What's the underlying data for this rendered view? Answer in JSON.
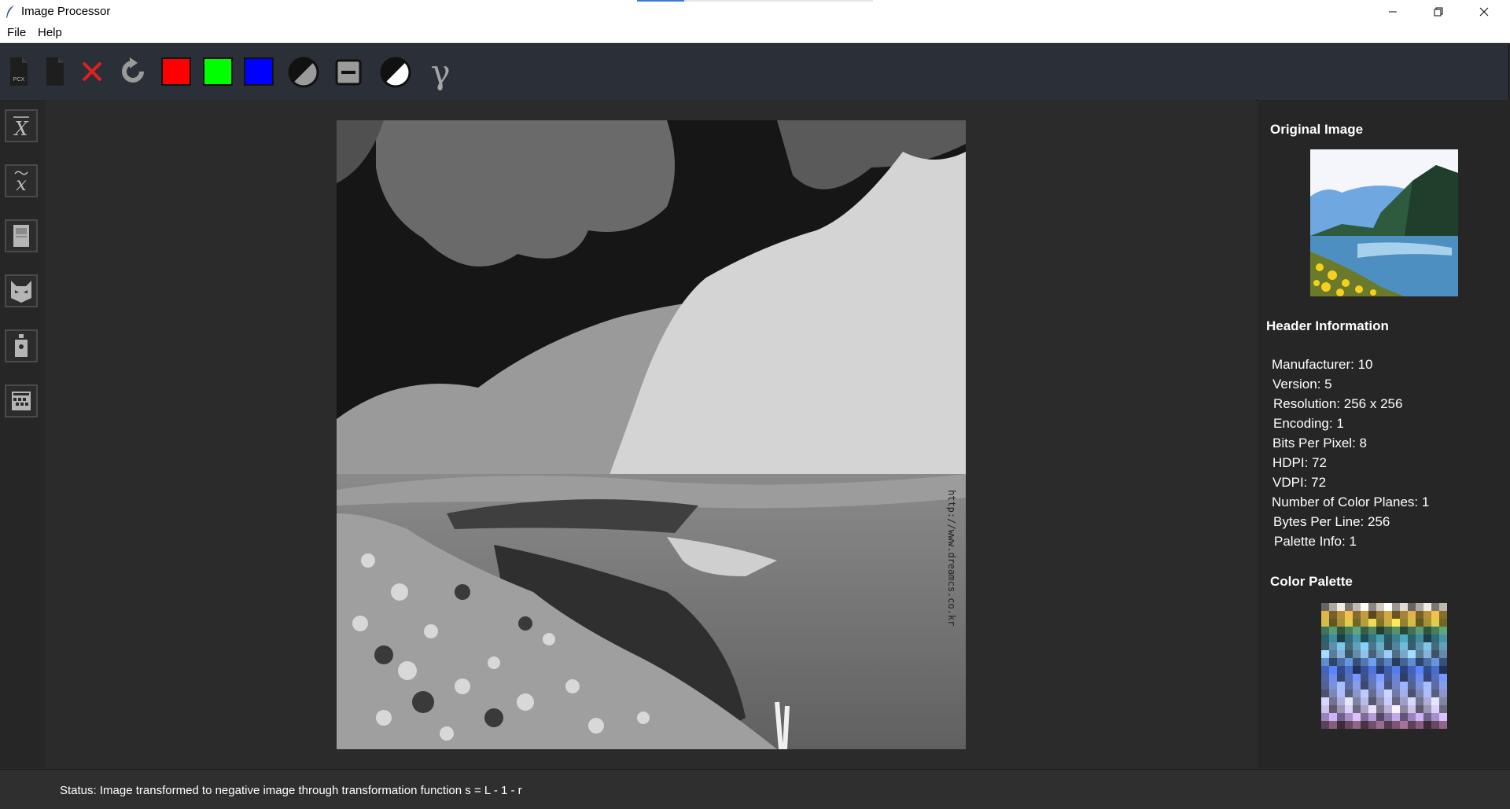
{
  "window": {
    "title": "Image Processor",
    "controls": [
      "minimize-icon",
      "restore-icon",
      "close-icon"
    ]
  },
  "menu": {
    "items": [
      "File",
      "Help"
    ]
  },
  "toolbar": {
    "buttons": [
      {
        "name": "open-pcx-button",
        "icon": "pcx-file-icon",
        "label": "PCX"
      },
      {
        "name": "save-file-button",
        "icon": "file-icon"
      },
      {
        "name": "close-image-button",
        "icon": "red-x-icon"
      },
      {
        "name": "reset-button",
        "icon": "refresh-icon"
      },
      {
        "name": "red-channel-button",
        "icon": "red-square",
        "color": "#ff0000"
      },
      {
        "name": "green-channel-button",
        "icon": "green-square",
        "color": "#00ff00"
      },
      {
        "name": "blue-channel-button",
        "icon": "blue-square",
        "color": "#0000ff"
      },
      {
        "name": "grayscale-button",
        "icon": "half-circle-icon"
      },
      {
        "name": "threshold-button",
        "icon": "minus-box-icon"
      },
      {
        "name": "negative-button",
        "icon": "negative-circle-icon"
      },
      {
        "name": "gamma-button",
        "icon": "gamma-icon",
        "label": "γ"
      }
    ]
  },
  "sidebar": {
    "buttons": [
      {
        "name": "mean-filter-button",
        "icon": "x-bar-icon",
        "label": "X"
      },
      {
        "name": "median-filter-button",
        "icon": "x-tilde-icon",
        "label": "x"
      },
      {
        "name": "histogram-button",
        "icon": "portrait-icon"
      },
      {
        "name": "edge-detect-button",
        "icon": "cat-icon"
      },
      {
        "name": "salt-pepper-button",
        "icon": "shaker-icon"
      },
      {
        "name": "noise-button",
        "icon": "grid-icon"
      }
    ]
  },
  "right_panel": {
    "original_image_title": "Original Image",
    "header_title": "Header Information",
    "header_rows": [
      "Manufacturer: 10",
      "Version: 5",
      "Resolution: 256 x 256",
      "Encoding: 1",
      "Bits Per Pixel: 8",
      "HDPI: 72",
      "VDPI: 72",
      "Number of Color Planes: 1",
      "Bytes Per Line: 256",
      "Palette Info: 1"
    ],
    "palette_title": "Color Palette"
  },
  "image": {
    "watermark": "http://www.dreamcs.co.kr"
  },
  "status": {
    "text": "Status: Image transformed to negative image through transformation function s = L - 1 - r"
  },
  "colors": {
    "toolbar_bg": "#2b3038",
    "panel_bg": "#262626",
    "main_bg": "#2b2b2b",
    "red": "#ff0000",
    "green": "#00ff00",
    "blue": "#0000ff"
  }
}
